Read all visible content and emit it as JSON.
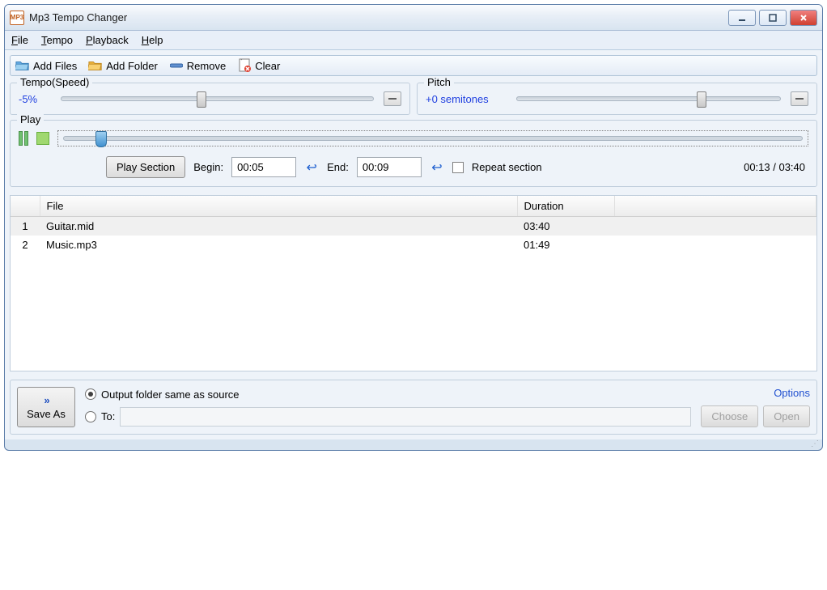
{
  "window": {
    "title": "Mp3 Tempo Changer",
    "app_icon_text": "MP3"
  },
  "menubar": {
    "file": "File",
    "tempo": "Tempo",
    "playback": "Playback",
    "help": "Help"
  },
  "toolbar": {
    "add_files": "Add Files",
    "add_folder": "Add Folder",
    "remove": "Remove",
    "clear": "Clear"
  },
  "tempo": {
    "legend": "Tempo(Speed)",
    "value": "-5%",
    "slider_pos_pct": 45
  },
  "pitch": {
    "legend": "Pitch",
    "value": "+0 semitones",
    "slider_pos_pct": 70
  },
  "play": {
    "legend": "Play",
    "progress_pos_pct": 5,
    "play_section_label": "Play Section",
    "begin_label": "Begin:",
    "begin_value": "00:05",
    "end_label": "End:",
    "end_value": "00:09",
    "repeat_label": "Repeat section",
    "repeat_checked": false,
    "time_display": "00:13 / 03:40"
  },
  "filelist": {
    "columns": {
      "num": "",
      "file": "File",
      "duration": "Duration"
    },
    "rows": [
      {
        "num": "1",
        "file": "Guitar.mid",
        "duration": "03:40",
        "selected": true
      },
      {
        "num": "2",
        "file": "Music.mp3",
        "duration": "01:49",
        "selected": false
      }
    ]
  },
  "footer": {
    "save_as_label": "Save As",
    "output_same_label": "Output folder same as source",
    "output_same_checked": true,
    "to_label": "To:",
    "to_checked": false,
    "to_path": "",
    "choose_label": "Choose",
    "open_label": "Open",
    "options_label": "Options"
  }
}
